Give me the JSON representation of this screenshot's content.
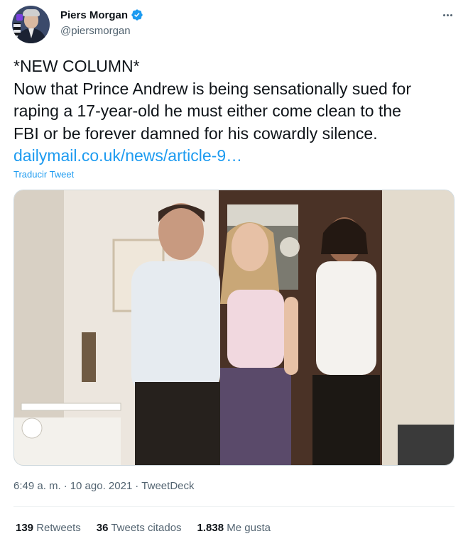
{
  "author": {
    "display_name": "Piers Morgan",
    "handle": "@piersmorgan",
    "verified": true
  },
  "icons": {
    "verified": "verified-badge-icon",
    "more": "more-options-icon"
  },
  "tweet": {
    "lines": [
      "*NEW COLUMN*",
      "Now that Prince Andrew is being sensationally sued for",
      "raping a 17-year-old he must either come clean to the",
      "FBI or be forever damned for his cowardly silence."
    ],
    "link_text": "dailymail.co.uk/news/article-9…",
    "translate_label": "Traducir Tweet"
  },
  "meta": {
    "time": "6:49 a. m.",
    "separator": "·",
    "date": "10 ago. 2021",
    "source": "TweetDeck"
  },
  "stats": {
    "retweets_count": "139",
    "retweets_label": "Retweets",
    "quotes_count": "36",
    "quotes_label": "Tweets citados",
    "likes_count": "1.838",
    "likes_label": "Me gusta"
  },
  "colors": {
    "accent": "#1d9bf0",
    "text_primary": "#0f1419",
    "text_secondary": "#536471",
    "divider": "#eff3f4"
  }
}
